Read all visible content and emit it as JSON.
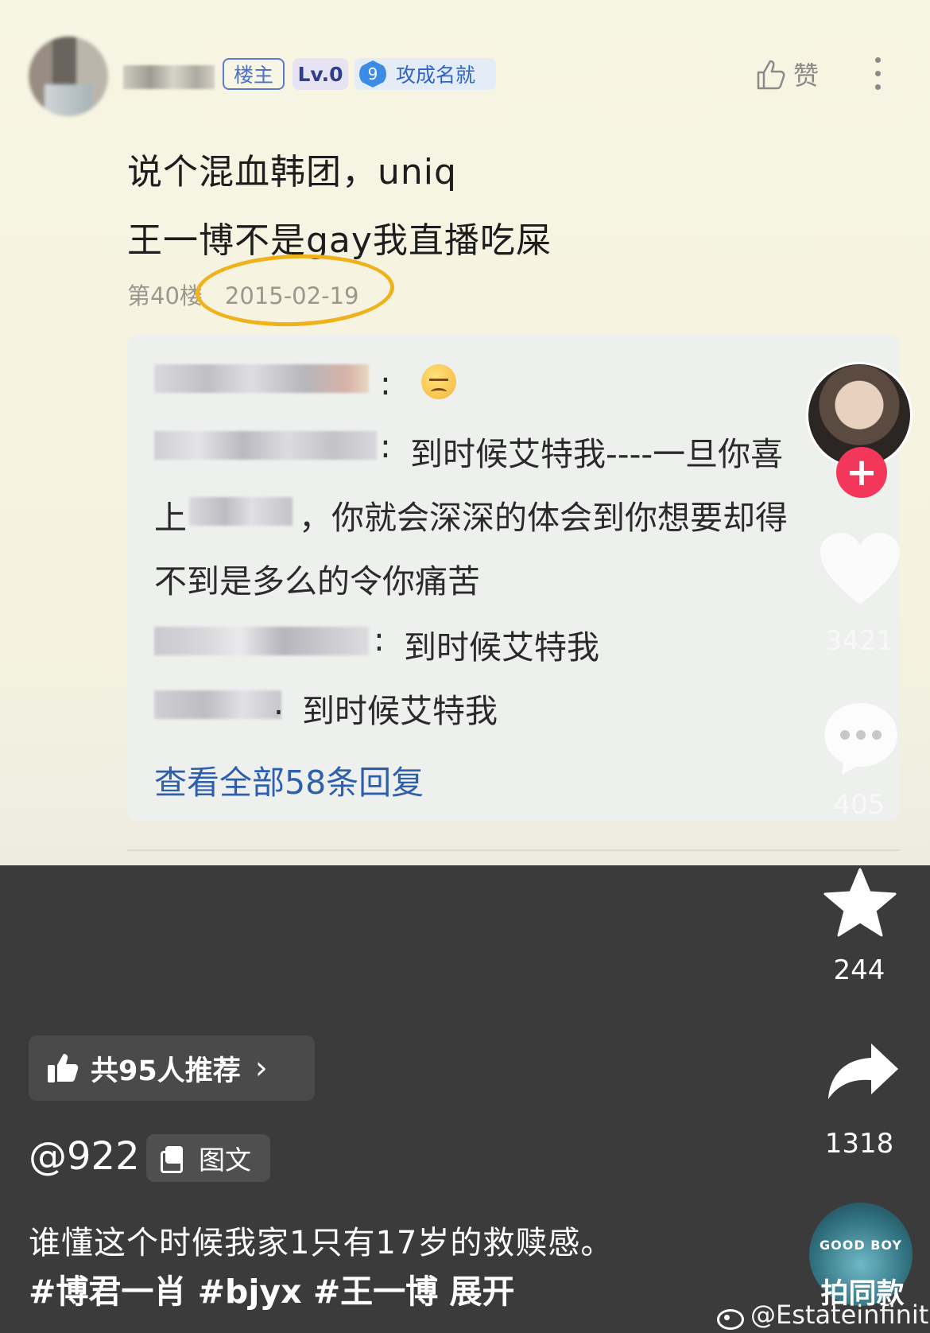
{
  "post": {
    "badges": {
      "host": "楼主",
      "level": "Lv.0",
      "rank_num": "9",
      "rank_name": "攻成名就"
    },
    "like_label": "赞",
    "text_line1": "说个混血韩团，uniq",
    "text_line2": "王一博不是gay我直播吃屎",
    "floor": "第40楼",
    "date": "2015-02-19"
  },
  "replies": [
    {
      "text": ""
    },
    {
      "text": "到时候艾特我----一旦你喜"
    },
    {
      "text_start": "上",
      "text_end": "，你就会深深的体会到你想要却得"
    },
    {
      "text": "不到是多么的令你痛苦"
    },
    {
      "text": "到时候艾特我"
    },
    {
      "text": "到时候艾特我"
    }
  ],
  "view_all": "查看全部58条回复",
  "rail": {
    "likes": "3421",
    "comments": "405",
    "favorites": "244",
    "shares": "1318",
    "music_label": "拍同款",
    "music_art_text": "GOOD BOY"
  },
  "recommend": {
    "label": "共95人推荐",
    "chevron": "›"
  },
  "author": {
    "handle": "@922",
    "type_tag": "图文"
  },
  "caption": "谁懂这个时候我家1只有17岁的救赎感。",
  "hashtags": "#博君一肖 #bjyx #王一博  展开",
  "watermark": "@Estateinfinita",
  "colors": {
    "highlight_circle": "#f0b21a",
    "plus_button": "#f2375a",
    "link_blue": "#2e5fae"
  }
}
